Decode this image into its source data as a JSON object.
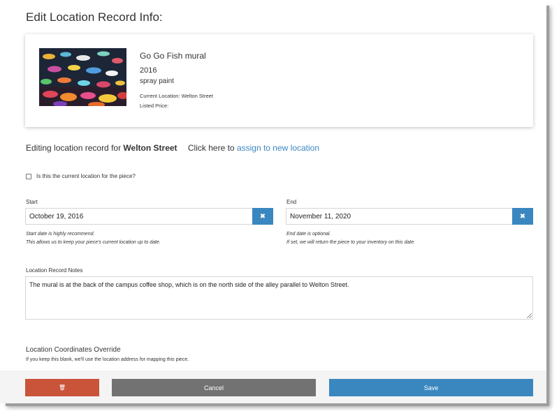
{
  "page": {
    "title": "Edit Location Record Info:"
  },
  "artwork": {
    "image_icon": "fish-mural-thumbnail",
    "name": "Go Go Fish mural",
    "year": "2016",
    "medium": "spray paint",
    "current_location": "Current Location: Welton Street",
    "listed_price": "Listed Price:"
  },
  "editing": {
    "prefix": "Editing location record for",
    "location": "Welton Street",
    "click_here": "Click here to",
    "assign_link": "assign to new location"
  },
  "current_checkbox": {
    "label": "Is this the current location for the piece?",
    "checked": false
  },
  "start": {
    "label": "Start",
    "value": "October 19, 2016",
    "clear_icon": "x-icon",
    "clear_glyph": "✖",
    "help_line1": "Start date is highly recommend.",
    "help_line2": "This allows us to keep your piece's current location up to date."
  },
  "end": {
    "label": "End",
    "value": "November 11, 2020",
    "clear_icon": "x-icon",
    "clear_glyph": "✖",
    "help_line1": "End date is optional.",
    "help_line2": "If set, we will return the piece to your inventory on this date."
  },
  "notes": {
    "label": "Location Record Notes",
    "value": "The mural is at the back of the campus coffee shop, which is on the north side of the alley parallel to Welton Street."
  },
  "coordinates": {
    "title": "Location Coordinates Override",
    "help": "If you keep this blank, we'll use the location address for mapping this piece."
  },
  "footer": {
    "delete_icon": "trash-icon",
    "delete_glyph": "🗑",
    "cancel_label": "Cancel",
    "save_label": "Save"
  },
  "colors": {
    "accent": "#3a87c0",
    "danger": "#c9543a",
    "neutral": "#727272"
  }
}
